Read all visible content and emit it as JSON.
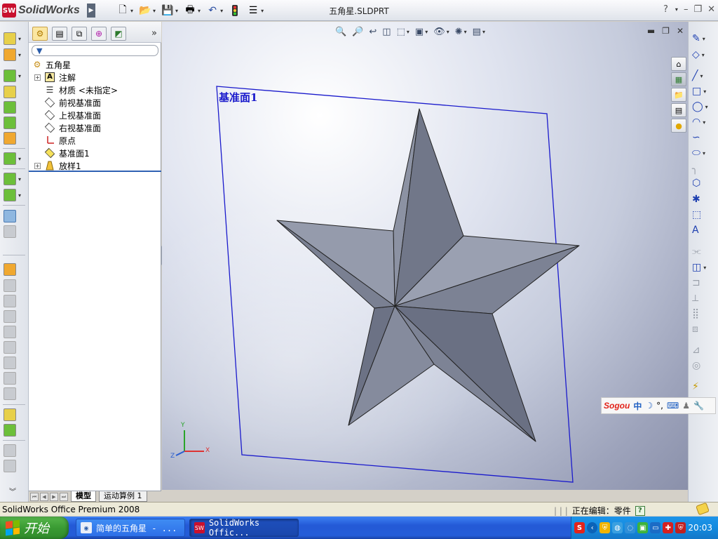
{
  "app": {
    "brand": "SolidWorks",
    "document_title": "五角星.SLDPRT"
  },
  "title_controls": [
    "?",
    "–",
    "❐",
    "✕"
  ],
  "feature_manager": {
    "root": "五角星",
    "items": [
      {
        "label": "注解",
        "icon": "annotation-icon",
        "expandable": true
      },
      {
        "label": "材质 <未指定>",
        "icon": "material-icon",
        "expandable": false
      },
      {
        "label": "前视基准面",
        "icon": "plane-icon",
        "expandable": false
      },
      {
        "label": "上视基准面",
        "icon": "plane-icon",
        "expandable": false
      },
      {
        "label": "右视基准面",
        "icon": "plane-icon",
        "expandable": false
      },
      {
        "label": "原点",
        "icon": "origin-icon",
        "expandable": false
      },
      {
        "label": "基准面1",
        "icon": "plane-icon",
        "expandable": false
      },
      {
        "label": "放样1",
        "icon": "loft-icon",
        "expandable": true
      }
    ],
    "more": "»",
    "bottom_tabs": [
      "模型",
      "运动算例 1"
    ]
  },
  "viewport": {
    "plane_label": "基准面1",
    "triad": {
      "y": "Y",
      "x": "X",
      "z": "Z"
    }
  },
  "ime": {
    "brand": "Sogou",
    "mode": "中",
    "moon": "☽",
    "punct": "°,"
  },
  "status": {
    "product": "SolidWorks Office Premium 2008",
    "separators": "| | |",
    "editing": "正在编辑：零件",
    "help": "?"
  },
  "taskbar": {
    "start": "开始",
    "tasks": [
      "简单的五角星 - ...",
      "SolidWorks Offic..."
    ],
    "clock": "20:03"
  },
  "colors": {
    "plane_blue": "#1a1acc",
    "star_gray": "#7b8193",
    "taskbar_blue": "#245dd8",
    "start_green": "#3a9b33"
  }
}
